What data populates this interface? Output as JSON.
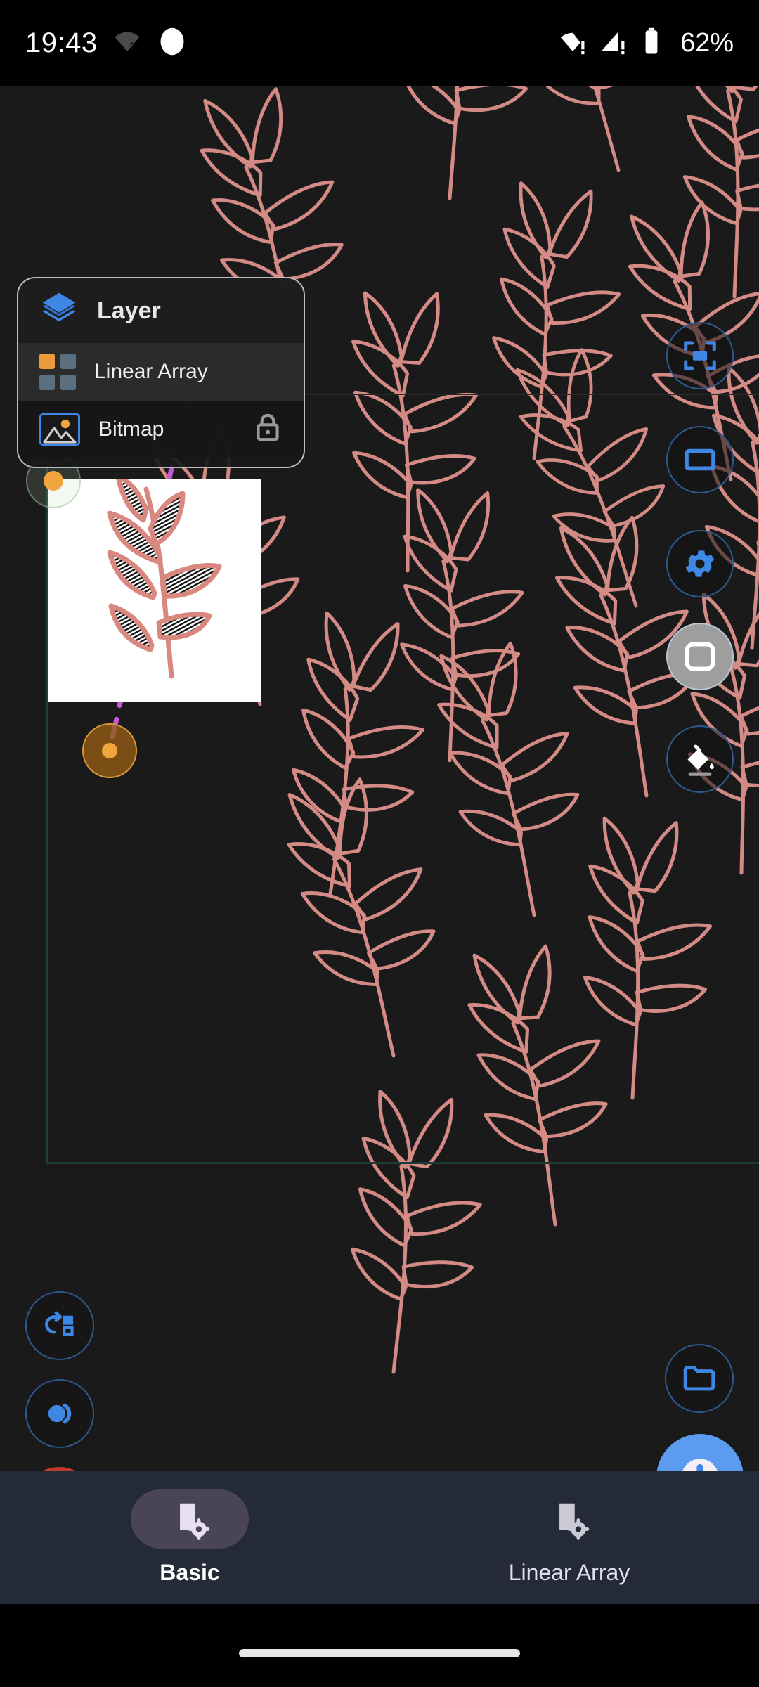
{
  "status_bar": {
    "clock": "19:43",
    "battery_percent": "62%",
    "icons": [
      "wifi-no-internet-icon",
      "cellular-no-internet-icon",
      "battery-icon"
    ],
    "notification_icons": [
      "wifi-question-icon",
      "dot-notification-icon"
    ]
  },
  "layer_panel": {
    "title": "Layer",
    "header_icon": "layers-icon",
    "rows": [
      {
        "label": "Linear Array",
        "icon": "grid-array-icon",
        "selected": true,
        "locked": false
      },
      {
        "label": "Bitmap",
        "icon": "bitmap-image-icon",
        "selected": false,
        "locked": true
      }
    ],
    "lock_icon": "lock-closed-icon"
  },
  "right_toolbar": {
    "buttons": [
      {
        "name": "fit-to-screen-button",
        "icon": "fit-to-screen-icon",
        "active": false
      },
      {
        "name": "rectangle-select-button",
        "icon": "rectangle-icon",
        "active": false
      },
      {
        "name": "settings-button",
        "icon": "gear-icon",
        "active": false
      },
      {
        "name": "shape-tool-button",
        "icon": "rounded-square-icon",
        "active": true
      },
      {
        "name": "fill-tool-button",
        "icon": "paint-bucket-icon",
        "active": false
      }
    ]
  },
  "left_tools": {
    "buttons": [
      {
        "name": "transform-button",
        "icon": "rotate-transform-icon"
      },
      {
        "name": "duplicate-button",
        "icon": "duplicate-circles-icon"
      },
      {
        "name": "delete-button",
        "icon": "trash-icon",
        "color": "#c0392b"
      }
    ]
  },
  "right_tools": {
    "buttons": [
      {
        "name": "open-folder-button",
        "icon": "folder-icon"
      },
      {
        "name": "add-button",
        "icon": "plus-icon",
        "color": "#5b9bf0"
      }
    ]
  },
  "bottom_nav": {
    "items": [
      {
        "label": "Basic",
        "icon": "shape-settings-icon",
        "selected": true
      },
      {
        "label": "Linear Array",
        "icon": "shape-settings-icon",
        "selected": false
      }
    ]
  },
  "colors": {
    "accent_blue": "#3f87e5",
    "handle_orange": "#f0a63c",
    "motif_pink": "#e0928c",
    "delete_red": "#c0392b",
    "nav_background": "#252a38",
    "canvas_background": "#1a1a1a",
    "guide_magenta": "#c259d6"
  },
  "canvas": {
    "motif": "leaf-branch-outline",
    "motif_count": 19,
    "bitmap_preview_background": "#ffffff"
  }
}
